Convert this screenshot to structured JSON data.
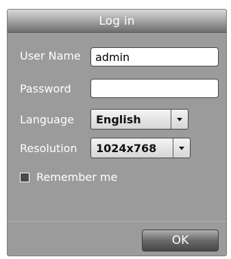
{
  "dialog": {
    "title": "Log in",
    "username": {
      "label": "User Name",
      "value": "admin",
      "placeholder": ""
    },
    "password": {
      "label": "Password",
      "value": "",
      "placeholder": ""
    },
    "language": {
      "label": "Language",
      "selected": "English"
    },
    "resolution": {
      "label": "Resolution",
      "selected": "1024x768"
    },
    "remember": {
      "label": "Remember me",
      "checked": false
    },
    "ok_label": "OK"
  },
  "colors": {
    "panel": "#9b9b9b",
    "title_text": "#ffffff",
    "field_bg": "#ffffff",
    "button_dark": "#474747"
  },
  "icons": {
    "dropdown": "chevron-down-icon",
    "checkbox": "checkbox-icon"
  }
}
